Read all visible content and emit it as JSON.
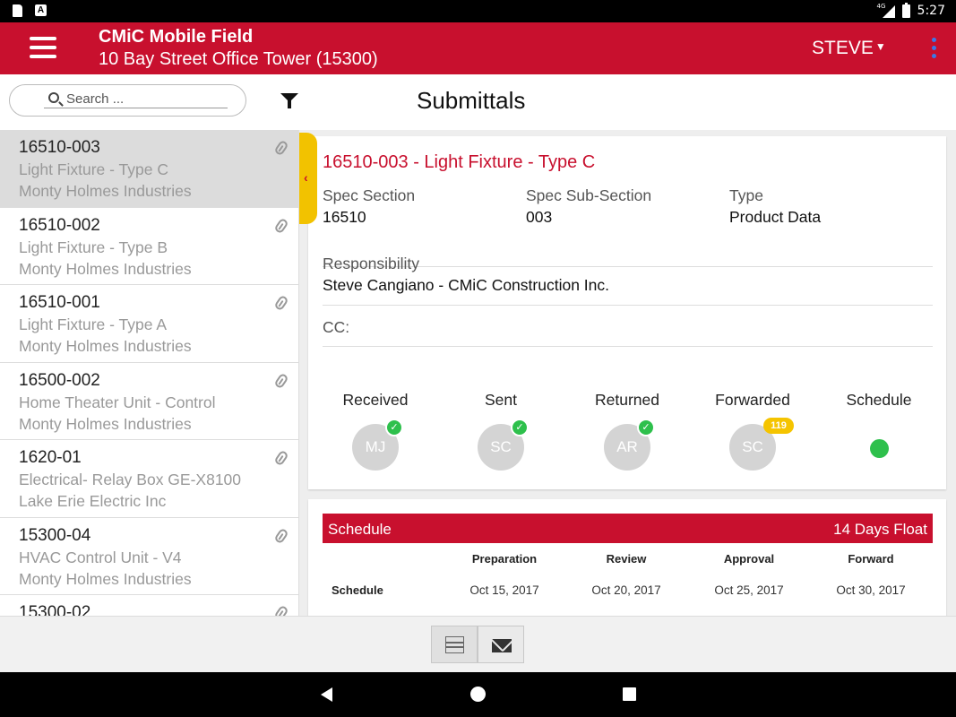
{
  "status_bar": {
    "network": "4G",
    "time": "5:27"
  },
  "app_bar": {
    "title": "CMiC Mobile Field",
    "project": "10 Bay Street Office Tower (15300)",
    "user": "STEVE",
    "accent_color": "#c8102e"
  },
  "toolbar": {
    "search_placeholder": "Search ...",
    "page_title": "Submittals"
  },
  "list": {
    "items": [
      {
        "id": "16510-003",
        "title": "Light Fixture - Type C",
        "company": "Monty Holmes Industries",
        "selected": true
      },
      {
        "id": "16510-002",
        "title": "Light Fixture - Type B",
        "company": "Monty Holmes Industries"
      },
      {
        "id": "16510-001",
        "title": "Light Fixture - Type A",
        "company": "Monty Holmes Industries"
      },
      {
        "id": "16500-002",
        "title": "Home Theater Unit - Control",
        "company": "Monty Holmes Industries"
      },
      {
        "id": "1620-01",
        "title": "Electrical- Relay Box GE-X8100",
        "company": "Lake Erie Electric Inc"
      },
      {
        "id": "15300-04",
        "title": "HVAC Control Unit - V4",
        "company": "Monty Holmes Industries"
      },
      {
        "id": "15300-02",
        "title": "",
        "company": ""
      }
    ]
  },
  "detail": {
    "title": "16510-003 - Light Fixture - Type C",
    "spec_section_label": "Spec Section",
    "spec_section_value": "16510",
    "spec_sub_section_label": "Spec Sub-Section",
    "spec_sub_section_value": "003",
    "type_label": "Type",
    "type_value": "Product Data",
    "responsibility_label": "Responsibility",
    "responsibility_value": "Steve Cangiano - CMiC Construction Inc.",
    "cc_label": "CC:",
    "status": [
      {
        "label": "Received",
        "initials": "MJ",
        "badge": "check"
      },
      {
        "label": "Sent",
        "initials": "SC",
        "badge": "check"
      },
      {
        "label": "Returned",
        "initials": "AR",
        "badge": "check"
      },
      {
        "label": "Forwarded",
        "initials": "SC",
        "badge_count": "119"
      },
      {
        "label": "Schedule",
        "indicator_color": "#2ec04c"
      }
    ]
  },
  "schedule": {
    "header": "Schedule",
    "float": "14 Days Float",
    "columns": [
      "Preparation",
      "Review",
      "Approval",
      "Forward"
    ],
    "row_label": "Schedule",
    "values": [
      "Oct 15, 2017",
      "Oct 20, 2017",
      "Oct 25, 2017",
      "Oct 30, 2017"
    ]
  }
}
